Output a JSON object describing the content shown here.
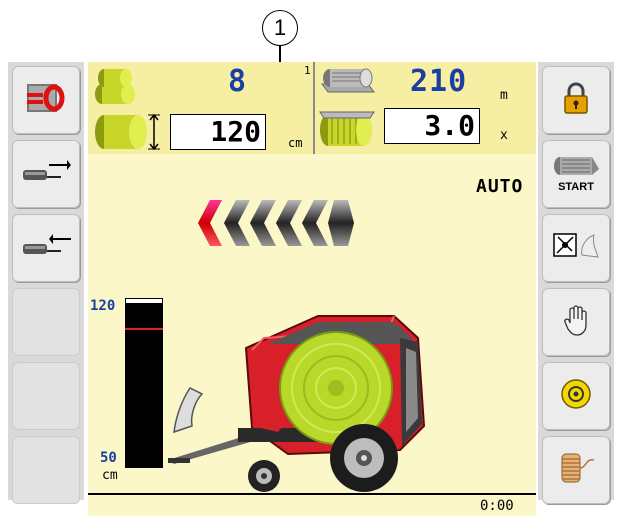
{
  "callout": {
    "label": "1"
  },
  "header": {
    "bale_count": "8",
    "bale_diameter": "120",
    "net_length": "210",
    "net_length_unit": "m",
    "net_indicator": "1",
    "net_wraps": "3.0",
    "net_wraps_unit": "x",
    "diameter_unit": "cm"
  },
  "mode": {
    "label": "AUTO"
  },
  "left_buttons": [
    {
      "name": "reset-counter-button",
      "icon": "reset-zero-icon",
      "glyph": "=0"
    },
    {
      "name": "extend-button",
      "icon": "extend-arrow-icon"
    },
    {
      "name": "retract-button",
      "icon": "retract-arrow-icon"
    },
    {
      "name": "empty-button-1"
    },
    {
      "name": "empty-button-2"
    },
    {
      "name": "empty-button-3"
    }
  ],
  "right_buttons": [
    {
      "name": "lock-button",
      "icon": "padlock-icon"
    },
    {
      "name": "start-net-button",
      "icon": "net-roll-icon",
      "label": "START"
    },
    {
      "name": "knife-button",
      "icon": "knife-icon"
    },
    {
      "name": "manual-button",
      "icon": "hand-icon"
    },
    {
      "name": "settings-button",
      "icon": "round-settings-icon"
    },
    {
      "name": "twine-button",
      "icon": "twine-spool-icon"
    }
  ],
  "gauge": {
    "max_label": "120",
    "min_label": "50",
    "unit": "cm",
    "fill_level": 0.9
  },
  "status": {
    "time": "0:00"
  },
  "colors": {
    "screen": "#fbf7c9",
    "header": "#f6efa3",
    "accent_blue": "#1a3fa0",
    "baler_red": "#d8202a"
  }
}
